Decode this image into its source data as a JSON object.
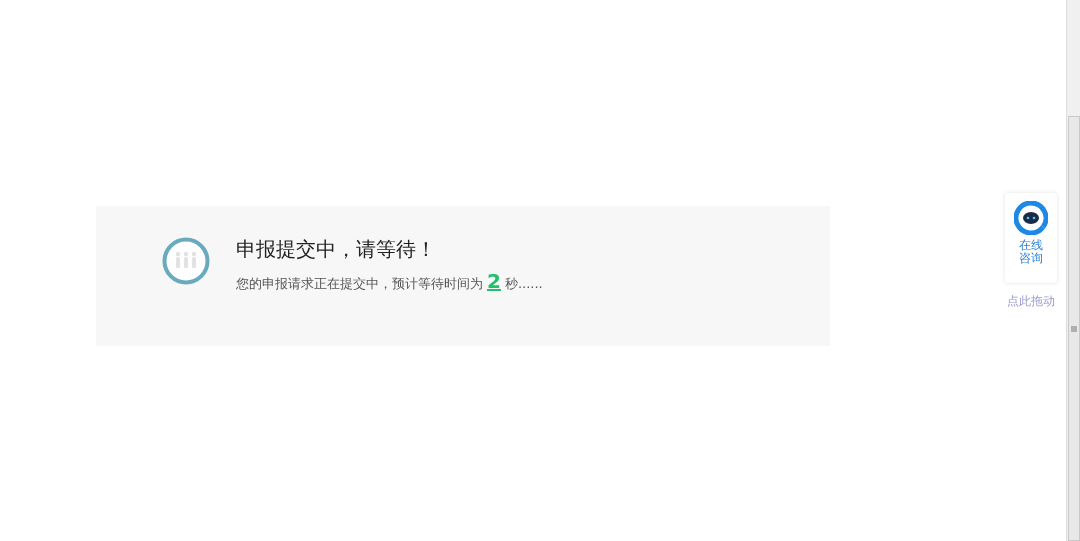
{
  "status_panel": {
    "title": "申报提交中，请等待！",
    "message_before": "您的申报请求正在提交中，预计等待时间为",
    "countdown": "2",
    "message_after": "秒......"
  },
  "consult_widget": {
    "label_line1": "在线",
    "label_line2": "咨询",
    "drag_hint": "点此拖动"
  }
}
